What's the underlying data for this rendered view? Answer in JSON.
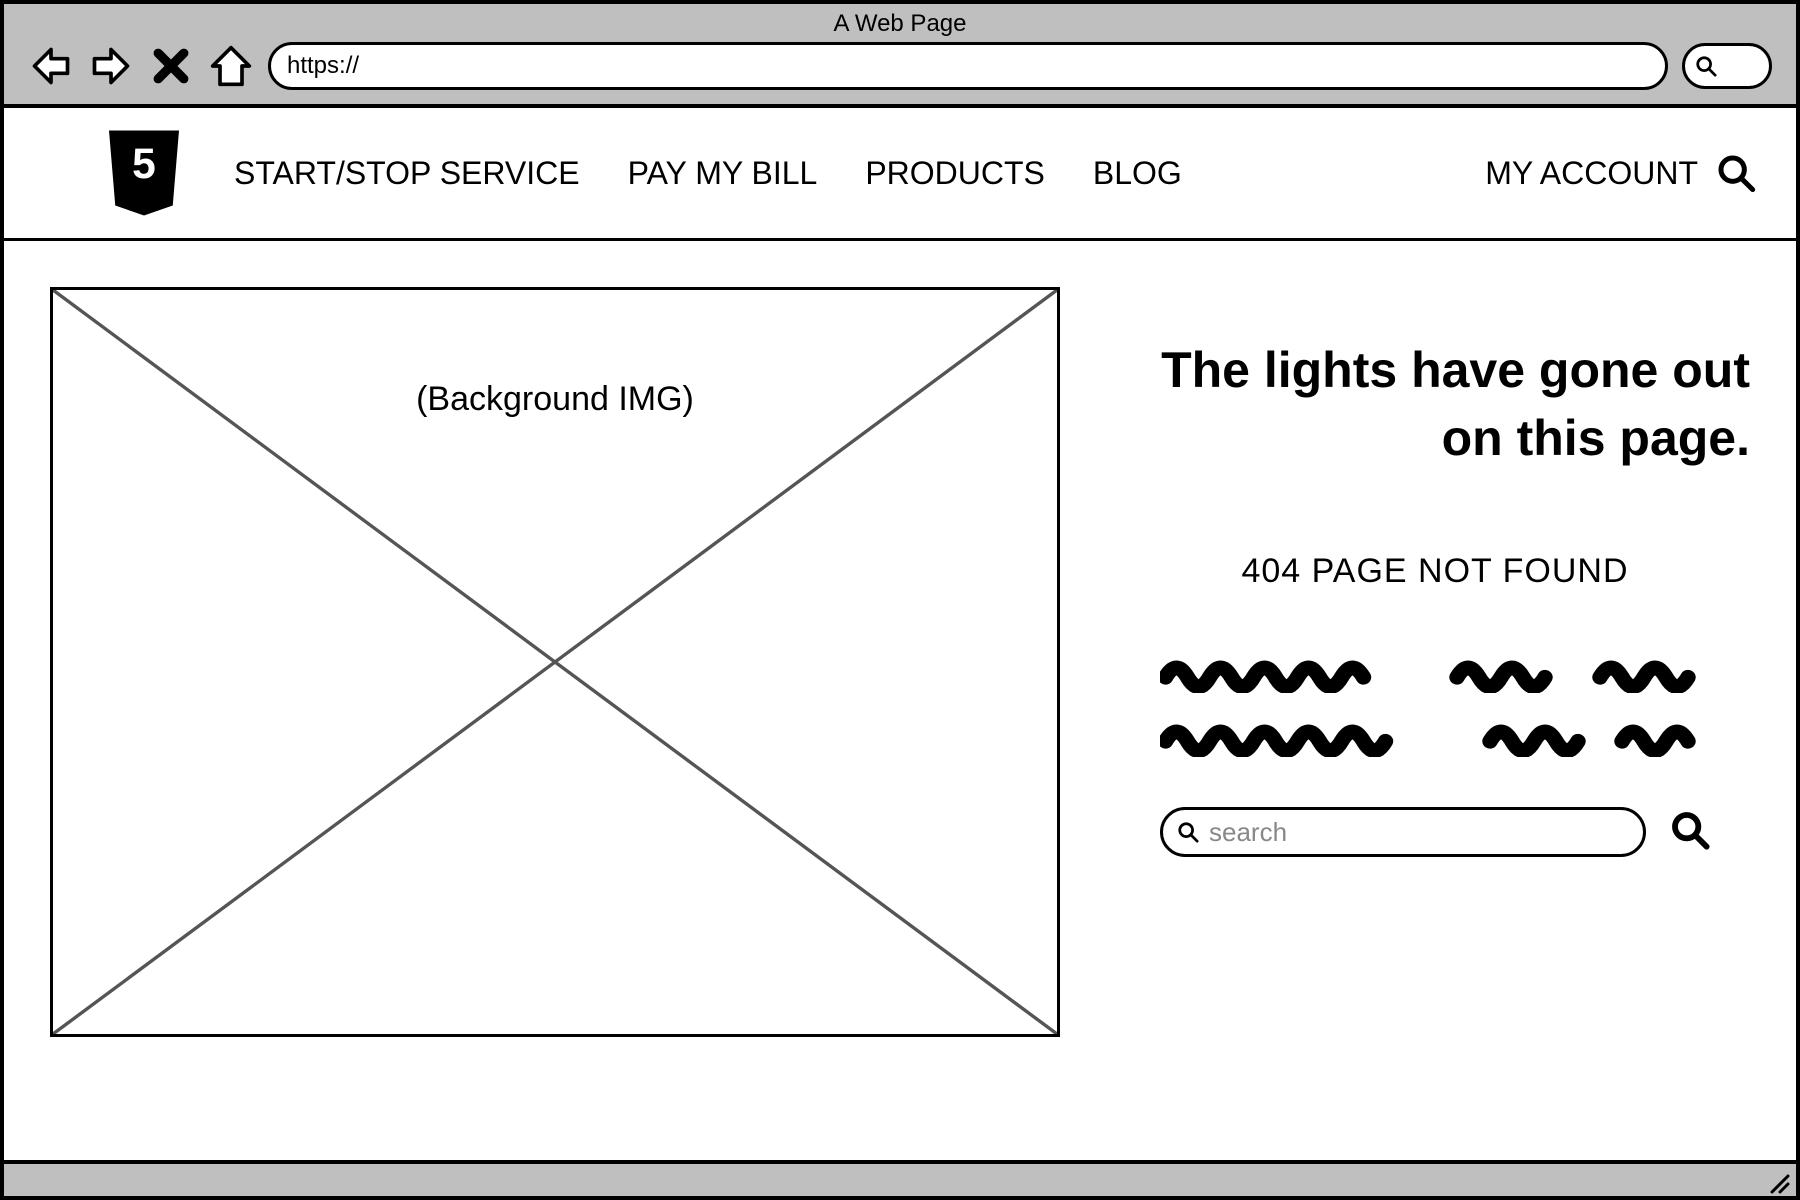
{
  "browser": {
    "title": "A Web Page",
    "url_prefix": "https://"
  },
  "header": {
    "nav": {
      "start_stop": "START/STOP SERVICE",
      "pay_bill": "PAY MY BILL",
      "products": "PRODUCTS",
      "blog": "BLOG"
    },
    "account_label": "MY ACCOUNT"
  },
  "content": {
    "image_caption": "(Background IMG)",
    "headline": "The lights have gone out on this page.",
    "subhead": "404 PAGE NOT FOUND",
    "search_placeholder": "search"
  }
}
